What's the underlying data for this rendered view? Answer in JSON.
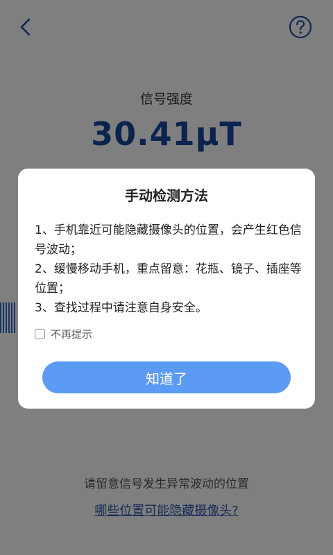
{
  "header": {
    "back_icon": "chevron-left-icon",
    "help_icon": "question-circle-icon",
    "accent_color": "#1f4fa3"
  },
  "signal": {
    "label": "信号强度",
    "value": "30.41μT",
    "value_color": "#16479f"
  },
  "dialog": {
    "title": "手动检测方法",
    "lines": [
      "1、手机靠近可能隐藏摄像头的位置，会产生红色信号波动；",
      "2、缓慢移动手机，重点留意：花瓶、镜子、插座等位置；",
      "3、查找过程中请注意自身安全。"
    ],
    "no_remind_label": "不再提示",
    "no_remind_checked": false,
    "ok_label": "知道了",
    "button_color": "#5b9bf6"
  },
  "footer": {
    "hint": "请留意信号发生异常波动的位置",
    "link": "哪些位置可能隐藏摄像头?"
  }
}
